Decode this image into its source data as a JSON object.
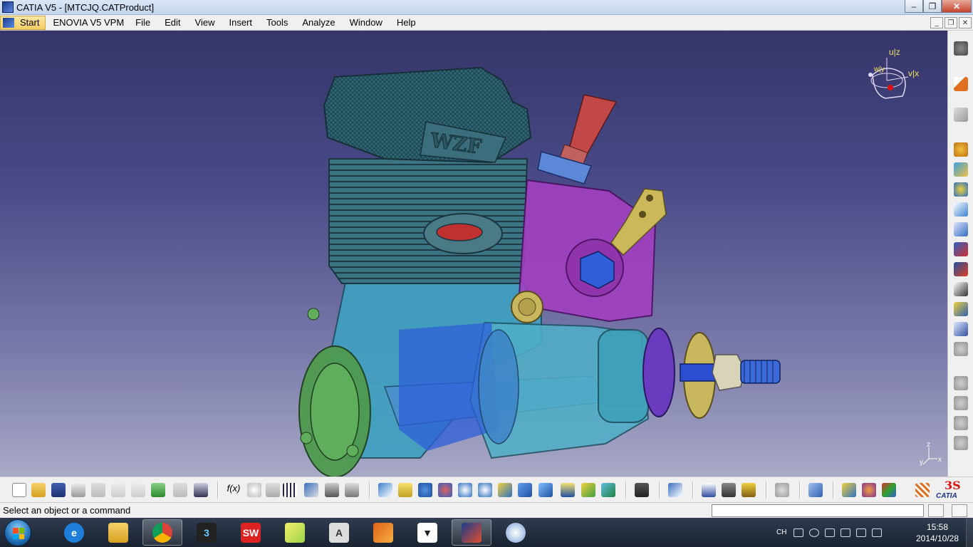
{
  "window": {
    "title": "CATIA V5 - [MTCJQ.CATProduct]"
  },
  "menubar": {
    "start_label": "Start",
    "items": [
      "ENOVIA V5 VPM",
      "File",
      "Edit",
      "View",
      "Insert",
      "Tools",
      "Analyze",
      "Window",
      "Help"
    ]
  },
  "viewport": {
    "engine_logo": "WZF",
    "compass": {
      "axis_u": "u|z",
      "axis_v": "v|x",
      "axis_w": "w|y"
    },
    "axis_triad": {
      "z": "z",
      "x": "x",
      "y": "y"
    }
  },
  "statusbar": {
    "message": "Select an object or a command",
    "command_value": ""
  },
  "toolbar": {
    "logo_text": "CATIA",
    "bottom_icons": [
      "new-icon",
      "open-icon",
      "save-icon",
      "print-icon",
      "cut-icon",
      "copy-icon",
      "paste-icon",
      "undo-icon",
      "redo-icon",
      "whats-this-icon",
      "formula-icon",
      "knowledge-icon",
      "marker-icon",
      "table-icon",
      "tree-icon",
      "lock-icon",
      "catalog-icon",
      "fly-mode-icon",
      "fit-all-icon",
      "pan-icon",
      "rotate-icon",
      "zoom-in-icon",
      "zoom-out-icon",
      "normal-view-icon",
      "multi-view-icon",
      "iso-view-icon",
      "hide-show-icon",
      "swap-visible-icon",
      "render-style-icon",
      "capture-icon",
      "product-icon",
      "measure-icon",
      "manipulate-icon",
      "analysis-icon",
      "update-icon",
      "generate-icon",
      "sectioning-icon",
      "scene-icon",
      "assembly-icon",
      "snap-icon"
    ],
    "right_icons": [
      "gear-icon",
      "select-icon",
      "sketch-select-icon",
      "update-constraints-icon",
      "constraint-icon",
      "assembly-constraint-icon",
      "insert-icon",
      "replace-icon",
      "move-icon",
      "explode-icon",
      "annotation-icon",
      "product-icon",
      "bom-icon",
      "cog-gray-icon",
      "cog-gray2-icon",
      "cog-gray3-icon",
      "compass-gray-icon",
      "snap-gray-icon"
    ]
  },
  "taskbar": {
    "apps": [
      "internet-explorer-icon",
      "file-explorer-icon",
      "chrome-icon",
      "3ds-max-icon",
      "solidworks-icon",
      "sticky-notes-icon",
      "autodesk-icon",
      "matlab-icon",
      "fox-app-icon",
      "catia-icon",
      "paint-icon"
    ],
    "tray_language": "CH",
    "time": "15:58",
    "date": "2014/10/28"
  },
  "colors": {
    "viewport_top": "#35356a",
    "viewport_bottom": "#a8a9c6",
    "cylinder": "#3e7a8a",
    "crankcase": "#3f9fc0",
    "carb": "#a23fc0",
    "backplate": "#4f9a4f",
    "prop_washer": "#c9b75e",
    "shaft": "#2b4fd0"
  }
}
